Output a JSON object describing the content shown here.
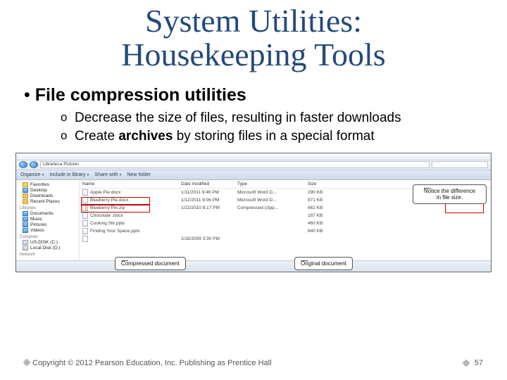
{
  "title_line1": "System Utilities:",
  "title_line2": "Housekeeping Tools",
  "bullet_main": "File compression utilities",
  "sub1": "Decrease the size of files, resulting in faster downloads",
  "sub2_pre": "Create ",
  "sub2_bold": "archives",
  "sub2_post": " by storing files in a special format",
  "explorer": {
    "breadcrumb": "Libraries ▸ Pictures",
    "toolbar": {
      "organize": "Organize",
      "include": "Include in library",
      "share": "Share with",
      "newfolder": "New folder"
    },
    "side": {
      "favorites": "Favorites",
      "desktop": "Desktop",
      "downloads": "Downloads",
      "recent": "Recent Places",
      "libraries": "Libraries",
      "documents": "Documents",
      "music": "Music",
      "pictures": "Pictures",
      "videos": "Videos",
      "computer": "Computer",
      "disk1": "US-DISK (C:)",
      "disk2": "Local Disk (D:)",
      "network": "Network"
    },
    "columns": {
      "name": "Name",
      "date": "Date modified",
      "type": "Type",
      "size": "Size"
    },
    "rows": [
      {
        "name": "Apple Pie.docx",
        "date": "1/11/2011 9:46 PM",
        "type": "Microsoft Word D...",
        "size": "290 KB"
      },
      {
        "name": "Blueberry Pie.docx",
        "date": "1/12/2011 9:06 PM",
        "type": "Microsoft Word D...",
        "size": "871 KB"
      },
      {
        "name": "Blueberry Pie.zip",
        "date": "1/22/2010 8:17 PM",
        "type": "Compressed (zipp...",
        "size": "662 KB"
      },
      {
        "name": "Chocolate  .docx",
        "date": "",
        "type": "",
        "size": "187 KB"
      },
      {
        "name": "Cooking Stir.pptx",
        "date": "",
        "type": "",
        "size": "460 KB"
      },
      {
        "name": "Finding Your Space.pptx",
        "date": "",
        "type": "",
        "size": "640 KB"
      },
      {
        "name": "",
        "date": "2/18/2009 3:30 PM",
        "type": "",
        "size": ""
      }
    ],
    "label_compressed": "Compressed document",
    "label_original": "Original document",
    "label_diff_l1": "Notice the difference",
    "label_diff_l2": "in file size."
  },
  "copyright": "Copyright © 2012 Pearson Education, Inc. Publishing as Prentice Hall",
  "page": "57"
}
